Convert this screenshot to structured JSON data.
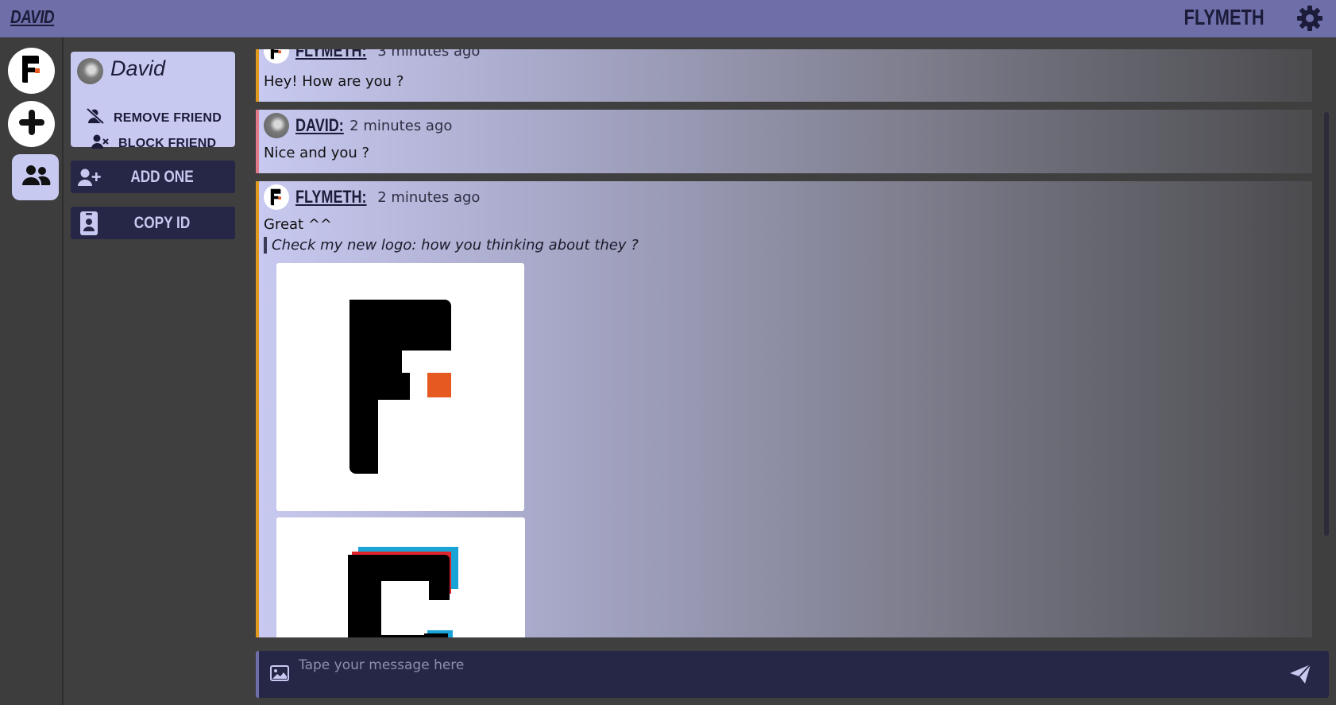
{
  "header": {
    "user_name": "DAVID",
    "app_name": "FLYMETH",
    "settings_icon": "gear-icon"
  },
  "rail": {
    "items": [
      {
        "name": "flymeth-server",
        "icon": "flymeth-logo-icon"
      },
      {
        "name": "add-server",
        "icon": "plus-icon"
      },
      {
        "name": "friends",
        "icon": "users-icon"
      }
    ]
  },
  "friend_card": {
    "name": "David",
    "remove_label": "REMOVE FRIEND",
    "block_label": "BLOCK FRIEND"
  },
  "panel": {
    "add_label": "ADD ONE",
    "copy_label": "COPY ID"
  },
  "messages": [
    {
      "author": "FLYMETH:",
      "time": "3 minutes ago",
      "text": "Hey! How are you ?"
    },
    {
      "author": "DAVID:",
      "time": "2 minutes ago",
      "text": "Nice and you ?"
    },
    {
      "author": "FLYMETH:",
      "time": "2 minutes ago",
      "text": "Great ^^",
      "quote": "Check my new logo: how you thinking about they ?"
    }
  ],
  "composer": {
    "placeholder": "Tape your message here"
  },
  "colors": {
    "header": "#6e6fa9",
    "card": "#c8c9f0",
    "button": "#262646",
    "accent_orange": "#e09a1f",
    "accent_pink": "#e07a8a",
    "logo_orange": "#e65a22"
  }
}
